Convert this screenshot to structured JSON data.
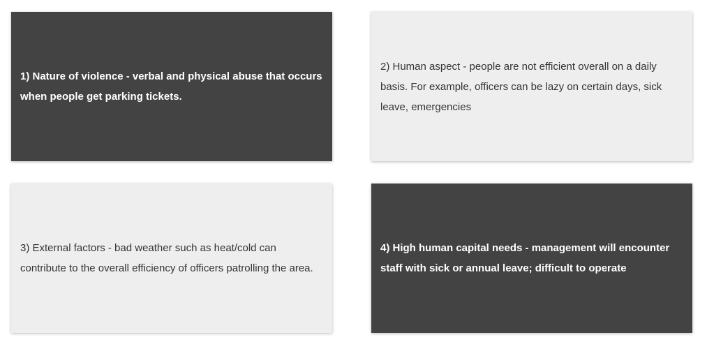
{
  "cards": [
    {
      "theme": "dark",
      "text": "1) Nature of violence - verbal and physical abuse that occurs when people get parking tickets."
    },
    {
      "theme": "light",
      "text": "2) Human aspect - people are not efficient overall on a daily basis. For example, officers can be lazy on certain days, sick leave, emergencies"
    },
    {
      "theme": "light",
      "text": "3) External factors - bad weather such as heat/cold can contribute to the overall efficiency of officers patrolling the area."
    },
    {
      "theme": "dark",
      "text": "4) High human capital needs - management will encounter staff with sick or annual leave; difficult to operate"
    }
  ],
  "colors": {
    "dark_card": "#434343",
    "light_card": "#eeeeee",
    "dark_text": "#ffffff",
    "light_text": "#333333"
  }
}
